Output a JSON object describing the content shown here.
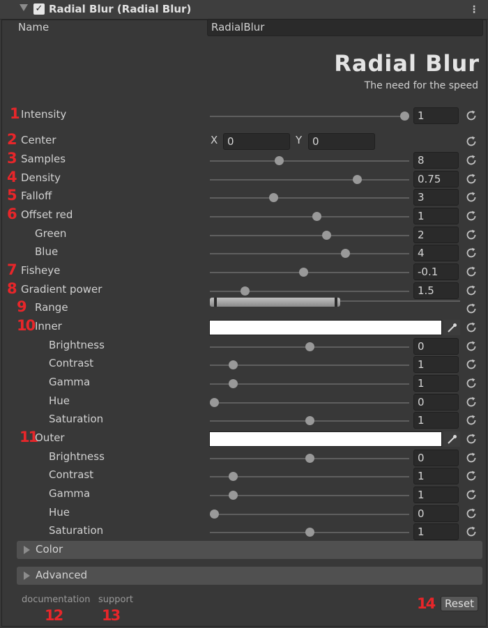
{
  "header": {
    "title": "Radial Blur (Radial Blur)",
    "enabled": true
  },
  "name_field": {
    "label": "Name",
    "value": "RadialBlur"
  },
  "logo": {
    "title": "Radial Blur",
    "subtitle": "The need for the speed"
  },
  "rows": [
    {
      "num": "1",
      "label": "Intensity",
      "value": "1",
      "slider": 1.0
    },
    {
      "num": "2",
      "label": "Center",
      "x_label": "X",
      "x_value": "0",
      "y_label": "Y",
      "y_value": "0"
    },
    {
      "num": "3",
      "label": "Samples",
      "value": "8",
      "slider": 0.34
    },
    {
      "num": "4",
      "label": "Density",
      "value": "0.75",
      "slider": 0.75
    },
    {
      "num": "5",
      "label": "Falloff",
      "value": "3",
      "slider": 0.31
    },
    {
      "num": "6",
      "label": "Offset red",
      "value": "1",
      "slider": 0.54
    },
    {
      "label": "Green",
      "value": "2",
      "slider": 0.59
    },
    {
      "label": "Blue",
      "value": "4",
      "slider": 0.69
    },
    {
      "num": "7",
      "label": "Fisheye",
      "value": "-0.1",
      "slider": 0.47
    },
    {
      "num": "8",
      "label": "Gradient power",
      "value": "1.5",
      "slider": 0.16
    },
    {
      "num": "9",
      "label": "Range"
    },
    {
      "num": "10",
      "label": "Inner",
      "color": "#ffffff"
    },
    {
      "label": "Brightness",
      "value": "0",
      "slider": 0.5
    },
    {
      "label": "Contrast",
      "value": "1",
      "slider": 0.1
    },
    {
      "label": "Gamma",
      "value": "1",
      "slider": 0.1
    },
    {
      "label": "Hue",
      "value": "0",
      "slider": 0.0
    },
    {
      "label": "Saturation",
      "value": "1",
      "slider": 0.5
    },
    {
      "num": "11",
      "label": "Outer",
      "color": "#ffffff"
    },
    {
      "label": "Brightness",
      "value": "0",
      "slider": 0.5
    },
    {
      "label": "Contrast",
      "value": "1",
      "slider": 0.1
    },
    {
      "label": "Gamma",
      "value": "1",
      "slider": 0.1
    },
    {
      "label": "Hue",
      "value": "0",
      "slider": 0.0
    },
    {
      "label": "Saturation",
      "value": "1",
      "slider": 0.5
    }
  ],
  "foldouts": {
    "color": "Color",
    "advanced": "Advanced"
  },
  "footer": {
    "documentation": "documentation",
    "support": "support",
    "reset": "Reset",
    "num_doc": "12",
    "num_support": "13",
    "num_reset": "14"
  },
  "colors": {
    "background": "#383838",
    "field": "#2a2a2a",
    "annotation": "#e8262a",
    "thumb": "#999999"
  },
  "icons": {
    "reset": "reset-icon",
    "eyedropper": "eyedropper-icon",
    "menu": "kebab-menu-icon",
    "fold": "foldout-arrow-icon"
  }
}
